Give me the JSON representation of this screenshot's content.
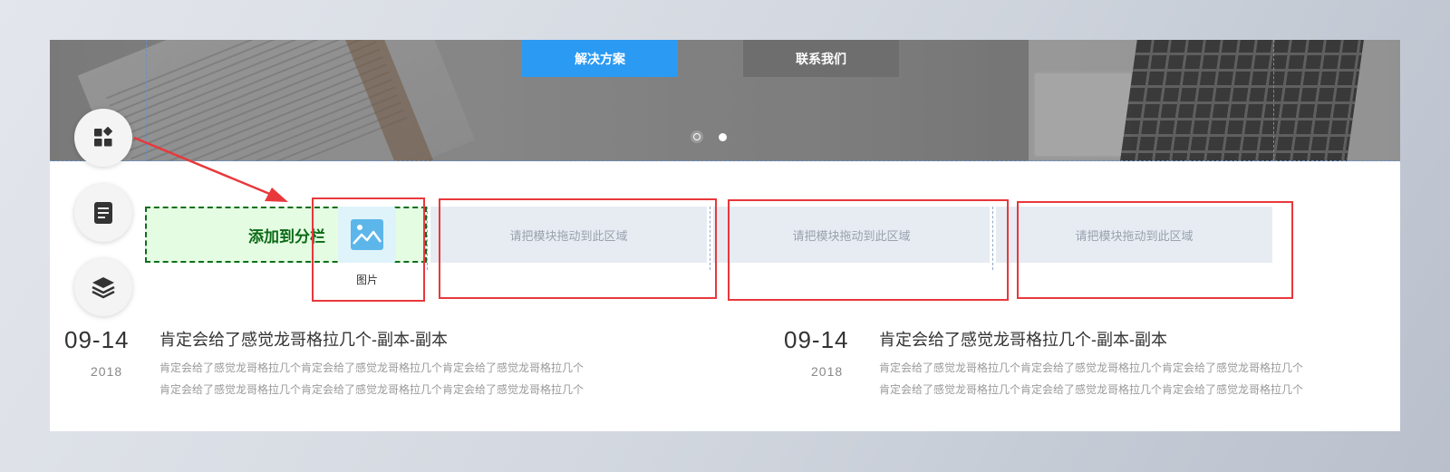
{
  "banner": {
    "primary_button": "解决方案",
    "secondary_button": "联系我们",
    "carousel": {
      "slides": 2,
      "active": 1
    }
  },
  "drop_zones": {
    "active_label": "添加到分栏",
    "empty_label": "请把模块拖动到此区域"
  },
  "drag_item": {
    "label": "图片",
    "icon": "image-icon"
  },
  "sidebar": {
    "items": [
      {
        "icon": "components-icon"
      },
      {
        "icon": "page-icon"
      },
      {
        "icon": "layers-icon"
      }
    ]
  },
  "news": [
    {
      "date": "09-14",
      "year": "2018",
      "title": "肯定会给了感觉龙哥格拉几个-副本-副本",
      "desc_line1": "肯定会给了感觉龙哥格拉几个肯定会给了感觉龙哥格拉几个肯定会给了感觉龙哥格拉几个",
      "desc_line2": "肯定会给了感觉龙哥格拉几个肯定会给了感觉龙哥格拉几个肯定会给了感觉龙哥格拉几个"
    },
    {
      "date": "09-14",
      "year": "2018",
      "title": "肯定会给了感觉龙哥格拉几个-副本-副本",
      "desc_line1": "肯定会给了感觉龙哥格拉几个肯定会给了感觉龙哥格拉几个肯定会给了感觉龙哥格拉几个",
      "desc_line2": "肯定会给了感觉龙哥格拉几个肯定会给了感觉龙哥格拉几个肯定会给了感觉龙哥格拉几个"
    }
  ],
  "colors": {
    "primary": "#2b9af3",
    "secondary": "#6e6e6e",
    "highlight_red": "#e8383c",
    "drop_green": "#0c6a16"
  }
}
